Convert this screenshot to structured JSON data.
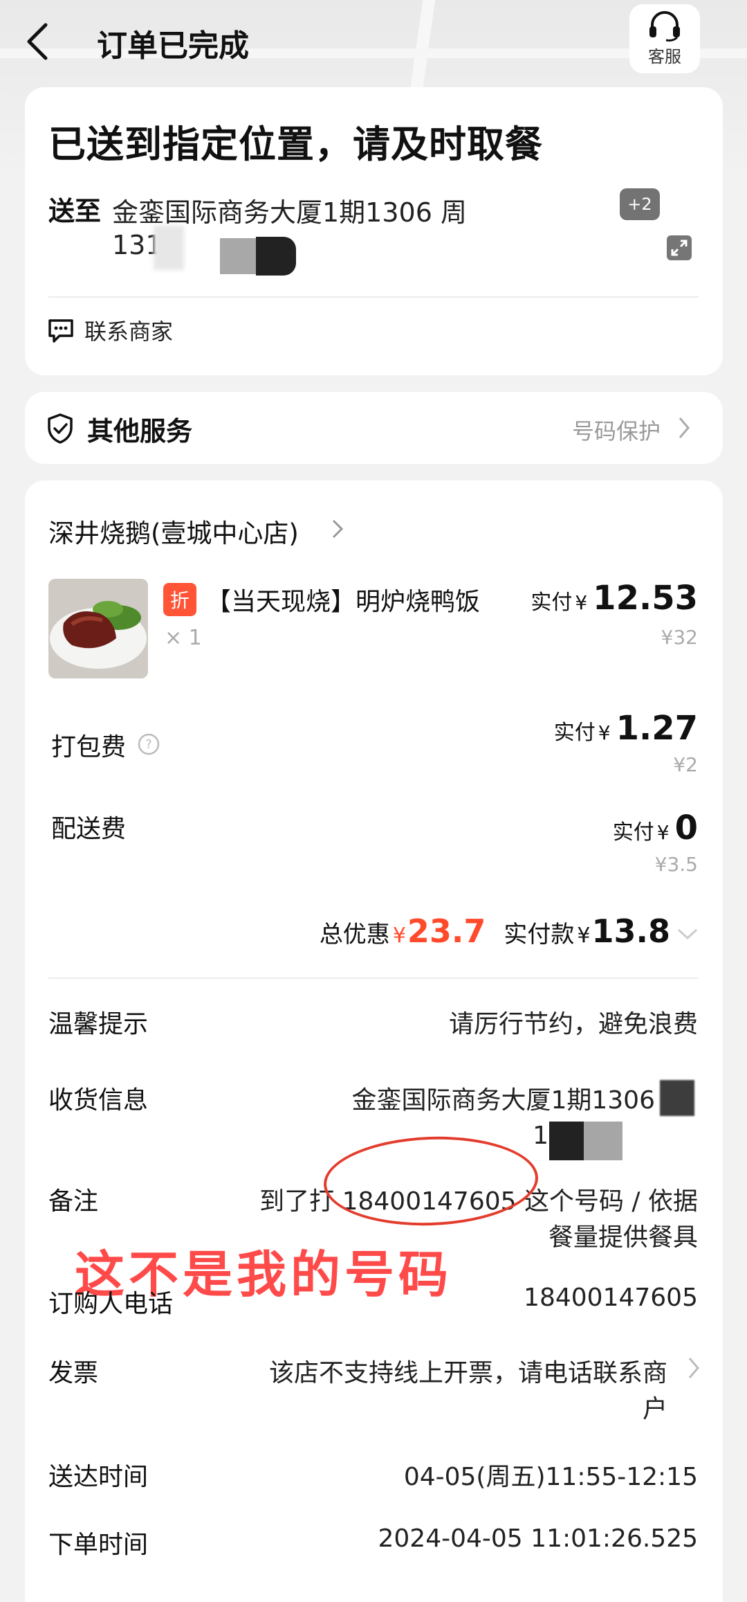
{
  "header": {
    "title": "订单已完成",
    "service_label": "客服"
  },
  "status": {
    "title": "已送到指定位置，请及时取餐",
    "address_label": "送至",
    "address_line1": "金銮国际商务大厦1期1306 周",
    "address_line2": "131",
    "extra_badge": "+2",
    "contact_label": "联系商家"
  },
  "services": {
    "title": "其他服务",
    "number_protection": "号码保护"
  },
  "order": {
    "shop_name": "深井烧鹅(壹城中心店)",
    "discount_tag": "折",
    "item_name": "【当天现烧】明炉烧鸭饭",
    "item_qty": "× 1",
    "pay_label": "实付",
    "currency": "¥",
    "item_paid": "12.53",
    "item_original": "¥32",
    "packing_label": "打包费",
    "packing_paid": "1.27",
    "packing_original": "¥2",
    "delivery_label": "配送费",
    "delivery_paid": "0",
    "delivery_original": "¥3.5",
    "total_discount_label": "总优惠",
    "total_discount": "23.7",
    "total_paid_label": "实付款",
    "total_paid": "13.8"
  },
  "info": {
    "tip_label": "温馨提示",
    "tip_value": "请厉行节约，避免浪费",
    "receiver_label": "收货信息",
    "receiver_line1": "金銮国际商务大厦1期1306",
    "receiver_line2": "1",
    "remark_label": "备注",
    "remark_line1_pre": "到了打 ",
    "remark_phone": "18400147605",
    "remark_line1_post": " 这个号码 / 依据",
    "remark_line2": "餐量提供餐具",
    "annotation": "这不是我的号码",
    "buyer_phone_label": "订购人电话",
    "buyer_phone": "18400147605",
    "invoice_label": "发票",
    "invoice_line1": "该店不支持线上开票，请电话联系商",
    "invoice_line2": "户",
    "arrival_label": "送达时间",
    "arrival_value": "04-05(周五)11:55-12:15",
    "order_time_label": "下单时间",
    "order_time_value": "2024-04-05 11:01:26.525"
  },
  "colors": {
    "accent_red": "#ff4a2b",
    "annotation_red": "#e43c2c",
    "discount_tag": "#ff5436"
  }
}
